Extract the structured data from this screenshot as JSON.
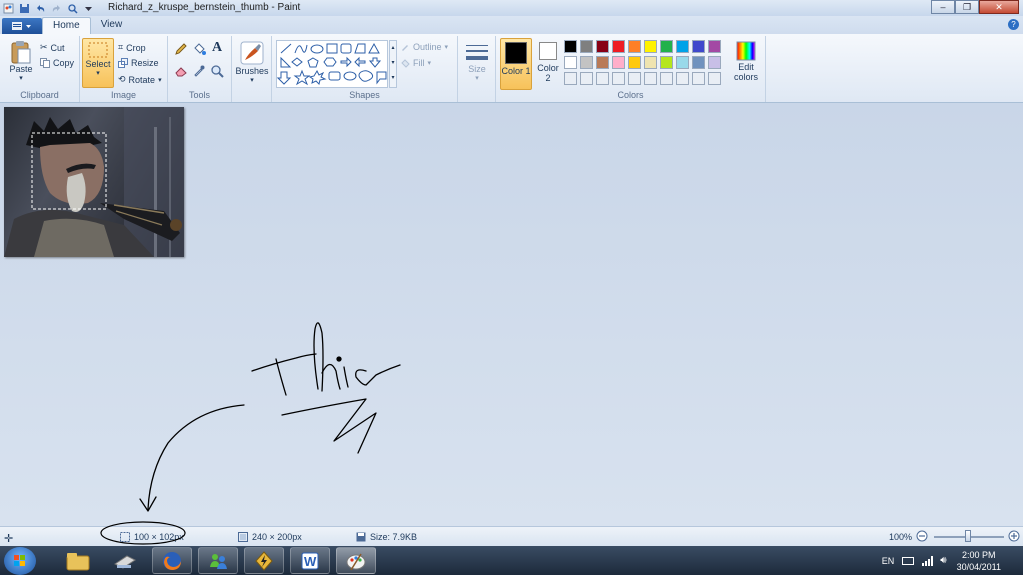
{
  "window": {
    "title": "Richard_z_kruspe_bernstein_thumb - Paint"
  },
  "tabs": [
    "Home",
    "View"
  ],
  "ribbon": {
    "clipboard": {
      "paste": "Paste",
      "cut": "Cut",
      "copy": "Copy",
      "label": "Clipboard"
    },
    "image": {
      "select": "Select",
      "crop": "Crop",
      "resize": "Resize",
      "rotate": "Rotate",
      "label": "Image"
    },
    "tools": {
      "label": "Tools"
    },
    "brushes": {
      "label": "Brushes"
    },
    "shapes": {
      "outline": "Outline",
      "fill": "Fill",
      "label": "Shapes"
    },
    "size": {
      "label": "Size"
    },
    "colors": {
      "color1": "Color 1",
      "color1_sub": "1",
      "color2": "Color",
      "color2_sub": "2",
      "edit": "Edit colors",
      "label": "Colors",
      "palette_row1": [
        "#000000",
        "#7f7f7f",
        "#880015",
        "#ed1c24",
        "#ff7f27",
        "#fff200",
        "#22b14c",
        "#00a2e8",
        "#3f48cc",
        "#a349a4"
      ],
      "palette_row2": [
        "#ffffff",
        "#c3c3c3",
        "#b97a57",
        "#ffaec9",
        "#ffc90e",
        "#efe4b0",
        "#b5e61d",
        "#99d9ea",
        "#7092be",
        "#c8bfe7"
      ]
    }
  },
  "canvas": {
    "handwriting": "This"
  },
  "statusbar": {
    "selection_size": "100 × 102px",
    "image_size": "240 × 200px",
    "file_size": "Size: 7.9KB",
    "zoom": "100%"
  },
  "taskbar": {
    "language": "EN",
    "time": "2:00 PM",
    "date": "30/04/2011"
  }
}
